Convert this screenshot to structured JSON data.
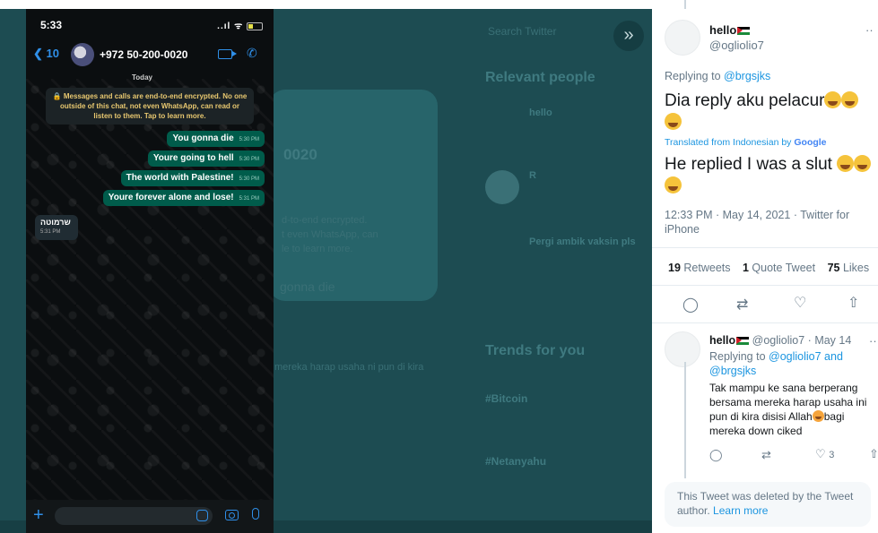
{
  "background": {
    "relevant_people": "Relevant people",
    "trends": "Trends for you",
    "search_placeholder": "Search Twitter",
    "card_number": "0020",
    "e2e_fragment": "d-to-end encrypted.\nt even WhatsApp, can\nle to learn more.",
    "card_msg": "gonna die",
    "person1_name": "hello",
    "person2_name": "R",
    "person3_name": "Pergi ambik vaksin pls",
    "bg_tweet_fragment": "mereka harap usaha ni pun di kira",
    "trend1": "#Bitcoin",
    "trend2": "#Netanyahu",
    "expand_icon": "»"
  },
  "whatsapp": {
    "time": "5:33",
    "signal": "..ıl",
    "back_count": "10",
    "contact": "+972 50-200-0020",
    "date_label": "Today",
    "e2e_notice": "🔒 Messages and calls are end-to-end encrypted. No one outside of this chat, not even WhatsApp, can read or listen to them. Tap to learn more.",
    "messages": [
      {
        "text": "You gonna die",
        "time": "5:30 PM"
      },
      {
        "text": "Youre going to hell",
        "time": "5:30 PM"
      },
      {
        "text": "The world with Palestine!",
        "time": "5:30 PM"
      },
      {
        "text": "Youre forever alone and lose!",
        "time": "5:31 PM"
      }
    ],
    "incoming": {
      "text": "שרמוטה",
      "time": "5:31 PM"
    }
  },
  "tweet": {
    "name": "hello",
    "handle": "@ogliolio7",
    "replying_prefix": "Replying to ",
    "replying_to": "@brgsjks",
    "text": "Dia reply aku pelacur",
    "translated_prefix": "Translated from Indonesian by ",
    "translator": "Google",
    "translation": "He replied I was a slut",
    "timestamp": "12:33 PM · May 14, 2021 · Twitter for iPhone",
    "retweets_count": "19",
    "retweets_label": "Retweets",
    "quotes_count": "1",
    "quotes_label": "Quote Tweet",
    "likes_count": "75",
    "likes_label": "Likes"
  },
  "reply": {
    "name": "hello",
    "handle_time": "@ogliolio7 · May 14",
    "replying_prefix": "Replying to ",
    "replying_to": "@ogliolio7 and @brgsjks",
    "text_before": "Tak mampu ke sana berperang bersama mereka harap usaha ini pun di kira disisi Allah",
    "text_after": "bagi mereka down ciked",
    "likes": "3"
  },
  "deleted": {
    "text": "This Tweet was deleted by the Tweet author.",
    "link": "Learn more"
  }
}
